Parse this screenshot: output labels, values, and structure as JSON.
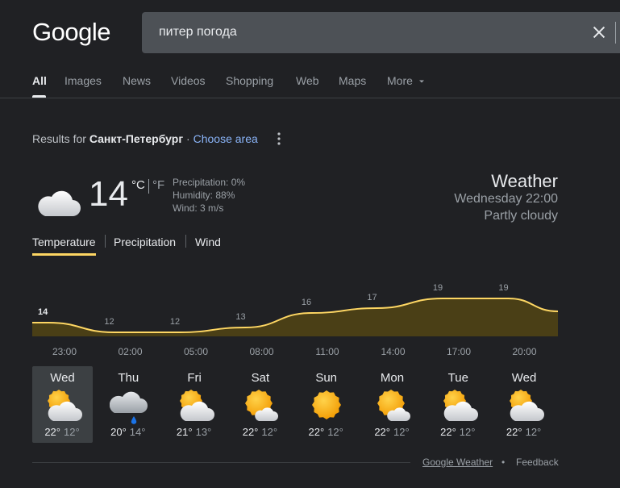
{
  "logo": "Google",
  "search": {
    "query": "питер погода"
  },
  "tabs": [
    {
      "label": "All"
    },
    {
      "label": "Images"
    },
    {
      "label": "News"
    },
    {
      "label": "Videos"
    },
    {
      "label": "Shopping"
    },
    {
      "label": "Web"
    },
    {
      "label": "Maps"
    },
    {
      "label": "More"
    }
  ],
  "location": {
    "prefix": "Results for",
    "city": "Санкт-Петербург",
    "sep": " · ",
    "choose": "Choose area"
  },
  "current": {
    "temp": "14",
    "unit_c": "°C",
    "unit_f": "°F",
    "precipitation": "Precipitation: 0%",
    "humidity": "Humidity: 88%",
    "wind": "Wind: 3 m/s",
    "title": "Weather",
    "time": "Wednesday 22:00",
    "condition": "Partly cloudy"
  },
  "subtabs": [
    {
      "label": "Temperature"
    },
    {
      "label": "Precipitation"
    },
    {
      "label": "Wind"
    }
  ],
  "chart_data": {
    "type": "area",
    "x": [
      "23:00",
      "02:00",
      "05:00",
      "08:00",
      "11:00",
      "14:00",
      "17:00",
      "20:00"
    ],
    "values": [
      14,
      12,
      12,
      13,
      16,
      17,
      19,
      19
    ],
    "labels": [
      "14",
      "12",
      "12",
      "13",
      "16",
      "17",
      "19",
      "19"
    ],
    "color": "#fdd663",
    "fill": "#4a3f16"
  },
  "forecast": [
    {
      "day": "Wed",
      "hi": "22°",
      "lo": "12°",
      "icon": "partly-cloudy-icon"
    },
    {
      "day": "Thu",
      "hi": "20°",
      "lo": "14°",
      "icon": "rain-icon"
    },
    {
      "day": "Fri",
      "hi": "21°",
      "lo": "13°",
      "icon": "partly-cloudy-icon"
    },
    {
      "day": "Sat",
      "hi": "22°",
      "lo": "12°",
      "icon": "mostly-sunny-icon"
    },
    {
      "day": "Sun",
      "hi": "22°",
      "lo": "12°",
      "icon": "sunny-icon"
    },
    {
      "day": "Mon",
      "hi": "22°",
      "lo": "12°",
      "icon": "mostly-sunny-icon"
    },
    {
      "day": "Tue",
      "hi": "22°",
      "lo": "12°",
      "icon": "partly-cloudy-icon"
    },
    {
      "day": "Wed",
      "hi": "22°",
      "lo": "12°",
      "icon": "partly-cloudy-icon"
    }
  ],
  "footer": {
    "source": "Google Weather",
    "bullet": "•",
    "feedback": "Feedback"
  }
}
